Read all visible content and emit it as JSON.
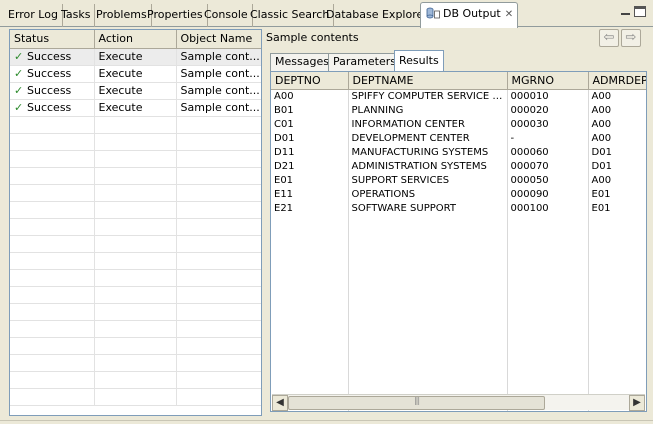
{
  "tabs": [
    {
      "label": "Error Log"
    },
    {
      "label": "Tasks"
    },
    {
      "label": "Problems"
    },
    {
      "label": "Properties"
    },
    {
      "label": "Console"
    },
    {
      "label": "Classic Search"
    },
    {
      "label": "Database Explorer"
    },
    {
      "label": "DB Output",
      "active": true
    }
  ],
  "icons": {
    "db_output": "db-output-icon",
    "close": "close-icon",
    "minimize": "minimize-icon",
    "maximize": "maximize-icon",
    "back": "back-arrow-icon",
    "forward": "forward-arrow-icon",
    "check": "check-icon"
  },
  "left_table": {
    "columns": [
      "Status",
      "Action",
      "Object Name"
    ],
    "rows": [
      {
        "status": "Success",
        "action": "Execute",
        "object": "Sample cont..."
      },
      {
        "status": "Success",
        "action": "Execute",
        "object": "Sample cont..."
      },
      {
        "status": "Success",
        "action": "Execute",
        "object": "Sample cont..."
      },
      {
        "status": "Success",
        "action": "Execute",
        "object": "Sample cont..."
      }
    ]
  },
  "right": {
    "title": "Sample contents",
    "subtabs": [
      "Messages",
      "Parameters",
      "Results"
    ],
    "active_subtab": "Results",
    "columns": [
      "DEPTNO",
      "DEPTNAME",
      "MGRNO",
      "ADMRDEPT"
    ],
    "rows": [
      [
        "A00",
        "SPIFFY COMPUTER SERVICE DIV.",
        "000010",
        "A00"
      ],
      [
        "B01",
        "PLANNING",
        "000020",
        "A00"
      ],
      [
        "C01",
        "INFORMATION CENTER",
        "000030",
        "A00"
      ],
      [
        "D01",
        "DEVELOPMENT CENTER",
        "-",
        "A00"
      ],
      [
        "D11",
        "MANUFACTURING SYSTEMS",
        "000060",
        "D01"
      ],
      [
        "D21",
        "ADMINISTRATION SYSTEMS",
        "000070",
        "D01"
      ],
      [
        "E01",
        "SUPPORT SERVICES",
        "000050",
        "A00"
      ],
      [
        "E11",
        "OPERATIONS",
        "000090",
        "E01"
      ],
      [
        "E21",
        "SOFTWARE SUPPORT",
        "000100",
        "E01"
      ]
    ]
  }
}
